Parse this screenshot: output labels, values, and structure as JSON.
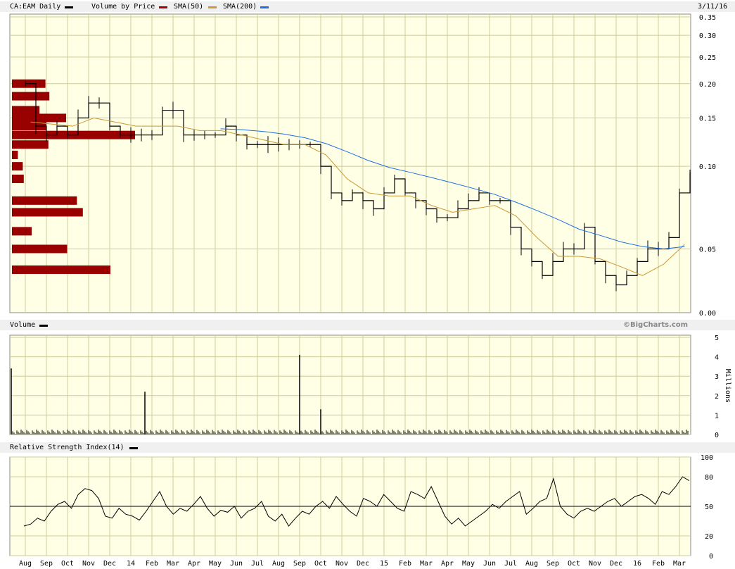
{
  "header": {
    "symbol": "CA:EAM Daily",
    "legend": [
      {
        "label": "Volume by Price",
        "color": "#990000"
      },
      {
        "label": "SMA(50)",
        "color": "#cc9933"
      },
      {
        "label": "SMA(200)",
        "color": "#1f6fe0"
      }
    ],
    "symbol_color": "#000000",
    "date": "3/11/16"
  },
  "volume_header": {
    "label": "Volume",
    "credit": "©BigCharts.com"
  },
  "rsi_header": {
    "label": "Relative Strength Index(14)"
  },
  "colors": {
    "plot_bg": "#ffffe6",
    "grid": "#cccc99",
    "bars": "#990000",
    "sma50": "#cc9933",
    "sma200": "#1f6fe0"
  },
  "chart_data": [
    {
      "type": "line",
      "title": "CA:EAM Daily",
      "scale": "log",
      "y_ticks": [
        "0.35",
        "0.30",
        "0.25",
        "0.20",
        "0.15",
        "0.10",
        "0.05",
        "0.00"
      ],
      "x_ticks": [
        "Aug",
        "Sep",
        "Oct",
        "Nov",
        "Dec",
        "14",
        "Feb",
        "Mar",
        "Apr",
        "May",
        "Jun",
        "Jul",
        "Aug",
        "Sep",
        "Oct",
        "Nov",
        "Dec",
        "15",
        "Feb",
        "Mar",
        "Apr",
        "May",
        "Jun",
        "Jul",
        "Aug",
        "Sep",
        "Oct",
        "Nov",
        "Dec",
        "16",
        "Feb",
        "Mar"
      ],
      "price_path": [
        [
          "Aug",
          0.2
        ],
        [
          "Aug",
          0.14
        ],
        [
          "Sep",
          0.13
        ],
        [
          "Sep",
          0.14
        ],
        [
          "Oct",
          0.13
        ],
        [
          "Oct",
          0.15
        ],
        [
          "Nov",
          0.17
        ],
        [
          "Nov",
          0.17
        ],
        [
          "Dec",
          0.14
        ],
        [
          "Dec",
          0.13
        ],
        [
          "14",
          0.13
        ],
        [
          "14",
          0.13
        ],
        [
          "Feb",
          0.13
        ],
        [
          "Feb",
          0.16
        ],
        [
          "Mar",
          0.16
        ],
        [
          "Mar",
          0.13
        ],
        [
          "Apr",
          0.13
        ],
        [
          "Apr",
          0.13
        ],
        [
          "May",
          0.13
        ],
        [
          "May",
          0.14
        ],
        [
          "Jun",
          0.13
        ],
        [
          "Jun",
          0.12
        ],
        [
          "Jul",
          0.12
        ],
        [
          "Jul",
          0.12
        ],
        [
          "Aug",
          0.12
        ],
        [
          "Aug",
          0.12
        ],
        [
          "Sep",
          0.12
        ],
        [
          "Sep",
          0.12
        ],
        [
          "Oct",
          0.1
        ],
        [
          "Oct",
          0.08
        ],
        [
          "Nov",
          0.075
        ],
        [
          "Nov",
          0.08
        ],
        [
          "Dec",
          0.075
        ],
        [
          "Dec",
          0.07
        ],
        [
          "15",
          0.08
        ],
        [
          "15",
          0.09
        ],
        [
          "Feb",
          0.08
        ],
        [
          "Feb",
          0.075
        ],
        [
          "Mar",
          0.07
        ],
        [
          "Mar",
          0.065
        ],
        [
          "Apr",
          0.065
        ],
        [
          "Apr",
          0.07
        ],
        [
          "May",
          0.075
        ],
        [
          "May",
          0.08
        ],
        [
          "Jun",
          0.075
        ],
        [
          "Jun",
          0.075
        ],
        [
          "Jul",
          0.06
        ],
        [
          "Jul",
          0.05
        ],
        [
          "Aug",
          0.045
        ],
        [
          "Aug",
          0.04
        ],
        [
          "Sep",
          0.045
        ],
        [
          "Sep",
          0.05
        ],
        [
          "Oct",
          0.05
        ],
        [
          "Oct",
          0.06
        ],
        [
          "Nov",
          0.045
        ],
        [
          "Nov",
          0.04
        ],
        [
          "Dec",
          0.037
        ],
        [
          "Dec",
          0.04
        ],
        [
          "16",
          0.045
        ],
        [
          "16",
          0.05
        ],
        [
          "Feb",
          0.05
        ],
        [
          "Feb",
          0.055
        ],
        [
          "Mar",
          0.08
        ],
        [
          "Mar",
          0.095
        ]
      ],
      "sma50": [
        [
          "Aug",
          0.145
        ],
        [
          "Oct",
          0.14
        ],
        [
          "Nov",
          0.15
        ],
        [
          "Dec",
          0.145
        ],
        [
          "14",
          0.14
        ],
        [
          "Feb",
          0.14
        ],
        [
          "Mar",
          0.14
        ],
        [
          "Apr",
          0.135
        ],
        [
          "May",
          0.135
        ],
        [
          "Jun",
          0.13
        ],
        [
          "Jul",
          0.125
        ],
        [
          "Aug",
          0.12
        ],
        [
          "Sep",
          0.12
        ],
        [
          "Oct",
          0.11
        ],
        [
          "Nov",
          0.09
        ],
        [
          "Dec",
          0.08
        ],
        [
          "15",
          0.078
        ],
        [
          "Feb",
          0.078
        ],
        [
          "Mar",
          0.072
        ],
        [
          "Apr",
          0.068
        ],
        [
          "May",
          0.07
        ],
        [
          "Jun",
          0.072
        ],
        [
          "Jul",
          0.066
        ],
        [
          "Aug",
          0.055
        ],
        [
          "Sep",
          0.047
        ],
        [
          "Oct",
          0.047
        ],
        [
          "Nov",
          0.046
        ],
        [
          "Dec",
          0.043
        ],
        [
          "16",
          0.04
        ],
        [
          "Feb",
          0.044
        ],
        [
          "Mar",
          0.052
        ]
      ],
      "sma200": [
        [
          "May",
          0.137
        ],
        [
          "Jun",
          0.136
        ],
        [
          "Jul",
          0.134
        ],
        [
          "Aug",
          0.131
        ],
        [
          "Sep",
          0.127
        ],
        [
          "Oct",
          0.121
        ],
        [
          "Nov",
          0.113
        ],
        [
          "Dec",
          0.105
        ],
        [
          "15",
          0.099
        ],
        [
          "Feb",
          0.095
        ],
        [
          "Mar",
          0.091
        ],
        [
          "Apr",
          0.087
        ],
        [
          "May",
          0.083
        ],
        [
          "Jun",
          0.079
        ],
        [
          "Jul",
          0.074
        ],
        [
          "Aug",
          0.069
        ],
        [
          "Sep",
          0.064
        ],
        [
          "Oct",
          0.059
        ],
        [
          "Nov",
          0.056
        ],
        [
          "Dec",
          0.053
        ],
        [
          "16",
          0.051
        ],
        [
          "Feb",
          0.05
        ],
        [
          "Mar",
          0.051
        ]
      ],
      "volume_by_price": [
        {
          "price": 0.2,
          "relative": 0.34
        },
        {
          "price": 0.18,
          "relative": 0.38
        },
        {
          "price": 0.16,
          "relative": 0.28
        },
        {
          "price": 0.15,
          "relative": 0.55
        },
        {
          "price": 0.14,
          "relative": 0.35
        },
        {
          "price": 0.13,
          "relative": 1.25
        },
        {
          "price": 0.12,
          "relative": 0.37
        },
        {
          "price": 0.11,
          "relative": 0.06
        },
        {
          "price": 0.1,
          "relative": 0.11
        },
        {
          "price": 0.09,
          "relative": 0.12
        },
        {
          "price": 0.075,
          "relative": 0.66
        },
        {
          "price": 0.068,
          "relative": 0.72
        },
        {
          "price": 0.058,
          "relative": 0.2
        },
        {
          "price": 0.05,
          "relative": 0.56
        },
        {
          "price": 0.042,
          "relative": 1.0
        }
      ]
    },
    {
      "type": "bar",
      "title": "Volume",
      "ylabel": "Millions",
      "y_ticks": [
        "5",
        "4",
        "3",
        "2",
        "1",
        "0"
      ],
      "ylim": [
        0,
        5
      ],
      "spikes": [
        {
          "x": "Aug",
          "value": 3.4
        },
        {
          "x": "Feb",
          "value": 2.2
        },
        {
          "x": "Sep",
          "value": 4.1
        },
        {
          "x": "Oct",
          "value": 1.3
        }
      ]
    },
    {
      "type": "line",
      "title": "Relative Strength Index(14)",
      "y_ticks": [
        "100",
        "80",
        "50",
        "20",
        "0"
      ],
      "ylim": [
        0,
        100
      ],
      "reference": 50,
      "values": [
        30,
        32,
        38,
        35,
        45,
        52,
        55,
        48,
        62,
        68,
        66,
        58,
        40,
        38,
        48,
        42,
        40,
        36,
        45,
        55,
        65,
        50,
        42,
        48,
        45,
        52,
        60,
        48,
        40,
        46,
        44,
        50,
        38,
        45,
        48,
        55,
        40,
        35,
        42,
        30,
        38,
        45,
        42,
        50,
        55,
        48,
        60,
        52,
        45,
        40,
        58,
        55,
        50,
        62,
        55,
        48,
        45,
        65,
        62,
        58,
        70,
        55,
        40,
        32,
        38,
        30,
        35,
        40,
        45,
        52,
        48,
        55,
        60,
        65,
        42,
        48,
        55,
        58,
        78,
        50,
        42,
        38,
        45,
        48,
        45,
        50,
        55,
        58,
        50,
        55,
        60,
        62,
        58,
        52,
        65,
        62,
        70,
        80,
        76
      ]
    }
  ]
}
